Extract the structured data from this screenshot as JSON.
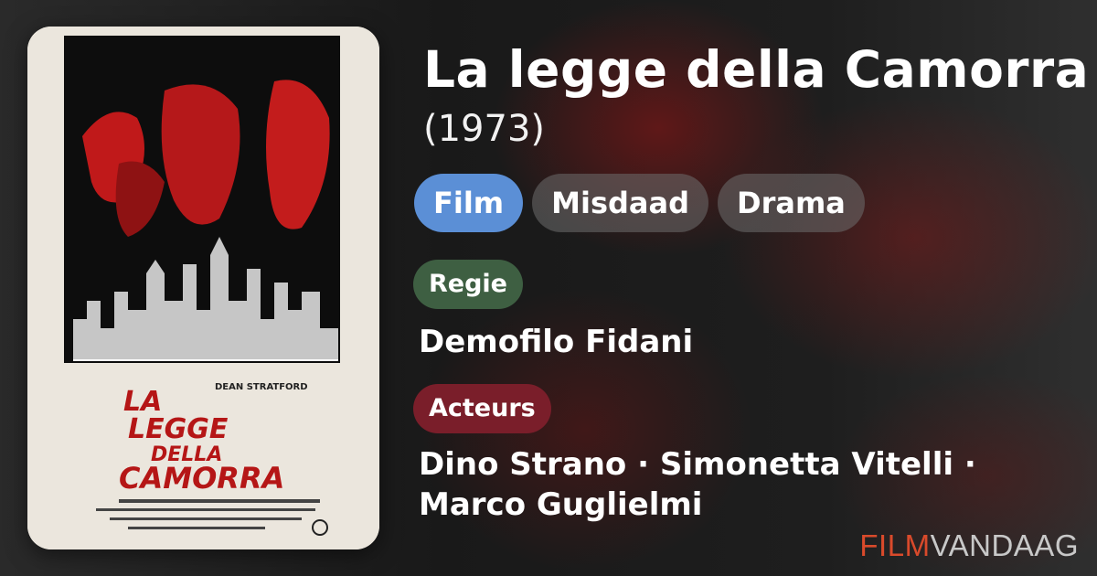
{
  "movie": {
    "title": "La legge della Camorra",
    "year": "(1973)"
  },
  "genres": [
    "Film",
    "Misdaad",
    "Drama"
  ],
  "directors": {
    "label": "Regie",
    "names": "Demofilo Fidani"
  },
  "actors": {
    "label": "Acteurs",
    "names": "Dino Strano · Simonetta Vitelli · Marco Guglielmi"
  },
  "brand": {
    "part1": "FILM",
    "part2": "VANDAAG"
  },
  "poster": {
    "title_line1": "LA",
    "title_line2": "LEGGE",
    "title_line3": "DELLA",
    "title_line4": "CAMORRA",
    "top_credit": "DEAN STRATFORD"
  },
  "colors": {
    "primary_chip": "#5b8fd6",
    "regie_chip": "#3e5f42",
    "acteurs_chip": "#7a1e2a",
    "brand_accent": "#d94a2b"
  }
}
